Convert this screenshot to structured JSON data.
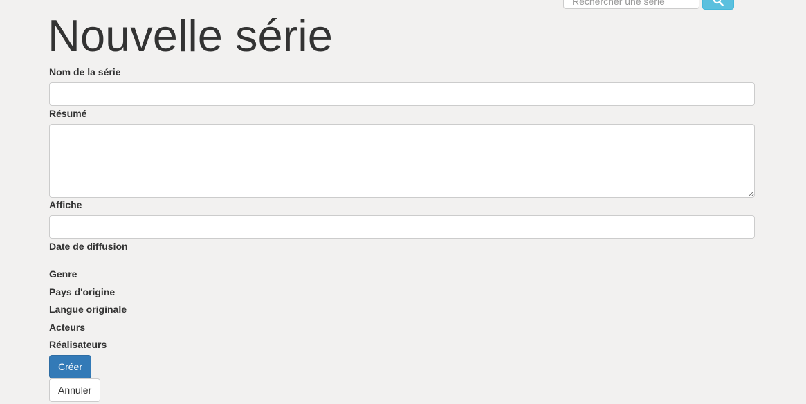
{
  "header": {
    "search": {
      "placeholder": "Rechercher une série",
      "value": ""
    },
    "search_button_icon": "search-icon"
  },
  "page": {
    "title": "Nouvelle série"
  },
  "form": {
    "name": {
      "label": "Nom de la série",
      "value": ""
    },
    "summary": {
      "label": "Résumé",
      "value": ""
    },
    "poster": {
      "label": "Affiche",
      "value": ""
    },
    "release_date": {
      "label": "Date de diffusion"
    },
    "genre": {
      "label": "Genre"
    },
    "country": {
      "label": "Pays d'origine"
    },
    "language": {
      "label": "Langue originale"
    },
    "actors": {
      "label": "Acteurs"
    },
    "directors": {
      "label": "Réalisateurs"
    },
    "submit_label": "Créer",
    "cancel_label": "Annuler"
  },
  "colors": {
    "background": "#f2f1f0",
    "primary": "#337ab7",
    "info": "#5bc0de"
  }
}
